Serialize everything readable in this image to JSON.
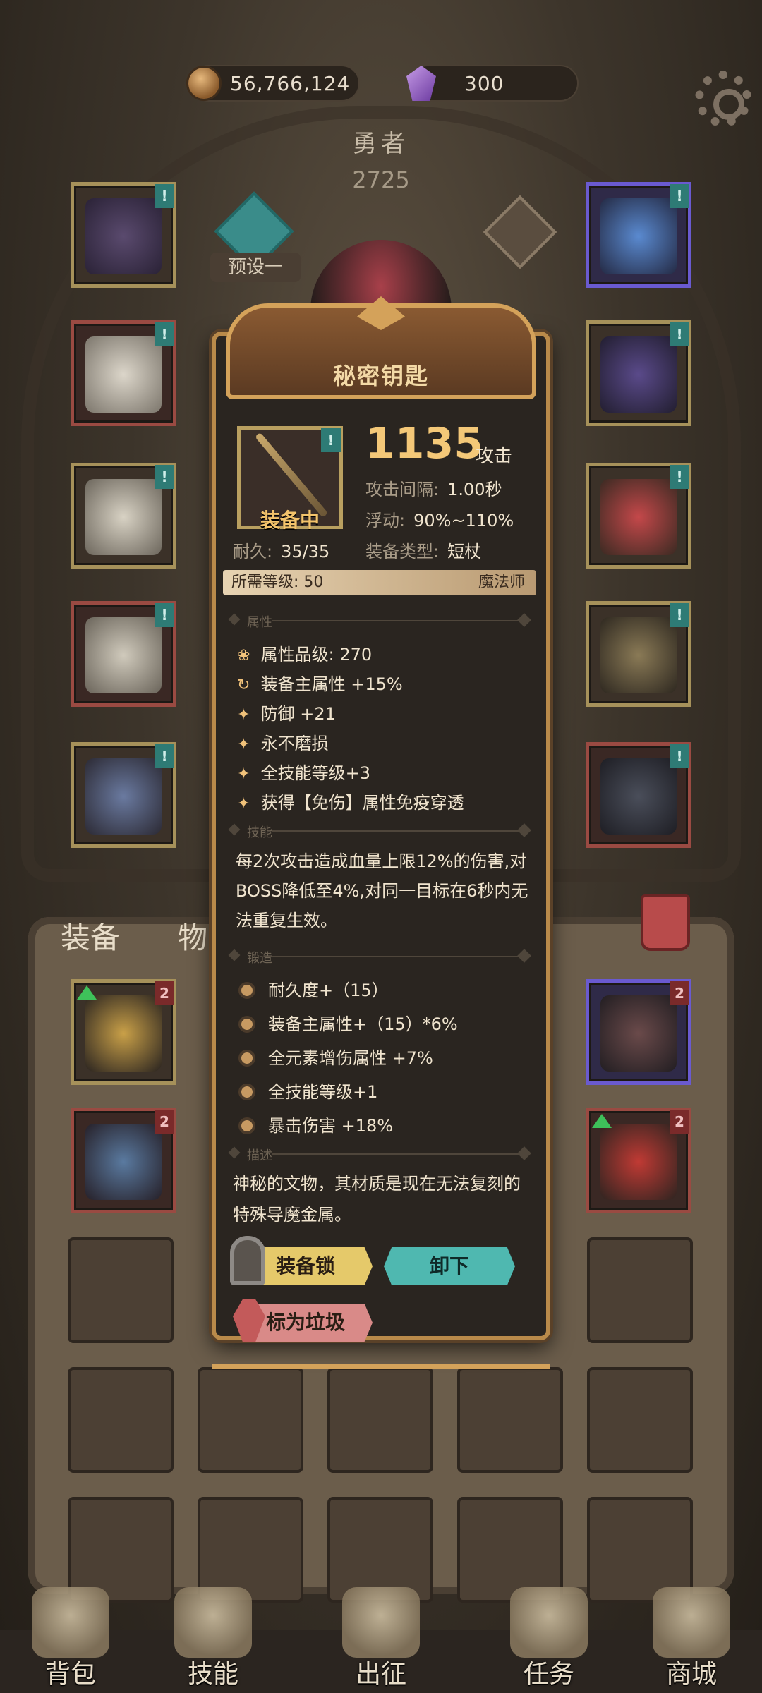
{
  "currency": {
    "gold": "56,766,124",
    "gems": "300",
    "gold_icon": "gold-coin-icon",
    "gem_icon": "purple-crystal-icon"
  },
  "hero": {
    "name": "勇者",
    "score": "2725",
    "preset_label": "预设一"
  },
  "equipment_slots": {
    "left": [
      "birdcage-helmet",
      "white-cloak",
      "white-armor",
      "white-leg-armor",
      "dark-boots"
    ],
    "right": [
      "blue-lantern-necklace",
      "purple-berry-amulet",
      "red-gem-ring",
      "staff",
      "wolf-head-item"
    ],
    "tag": "!"
  },
  "inventory": {
    "tab_equipment": "装备",
    "tab_items": "物",
    "badge": "2"
  },
  "tooltip": {
    "title": "秘密钥匙",
    "equipped_label": "装备中",
    "main_stat_value": "1135",
    "main_stat_unit": "攻击",
    "attack_interval_label": "攻击间隔:",
    "attack_interval_value": "1.00秒",
    "float_label": "浮动:",
    "float_value": "90%~110%",
    "durability_label": "耐久:",
    "durability_value": "35/35",
    "type_label": "装备类型:",
    "type_value": "短杖",
    "req_level_label": "所需等级:",
    "req_level_value": "50",
    "class": "魔法师",
    "section_attr": "属性",
    "attributes": [
      "属性品级: 270",
      "装备主属性 +15%",
      "防御 +21",
      "永不磨损",
      "全技能等级+3",
      "获得【免伤】属性免疫穿透"
    ],
    "section_skill": "技能",
    "skill_text": "每2次攻击造成血量上限12%的伤害,对BOSS降低至4%,对同一目标在6秒内无法重复生效。",
    "section_forge": "锻造",
    "forge": [
      "耐久度+（15）",
      "装备主属性+（15）*6%",
      "全元素增伤属性 +7%",
      "全技能等级+1",
      "暴击伤害 +18%"
    ],
    "section_desc": "描述",
    "description": "神秘的文物，其材质是现在无法复刻的特殊导魔金属。",
    "btn_lock": "装备锁",
    "btn_unequip": "卸下",
    "btn_trash": "标为垃圾"
  },
  "nav": [
    {
      "label": "背包",
      "icon": "backpack-icon"
    },
    {
      "label": "技能",
      "icon": "skill-book-icon"
    },
    {
      "label": "出征",
      "icon": "expedition-icon"
    },
    {
      "label": "任务",
      "icon": "quest-scroll-icon"
    },
    {
      "label": "商城",
      "icon": "shop-icon"
    }
  ]
}
